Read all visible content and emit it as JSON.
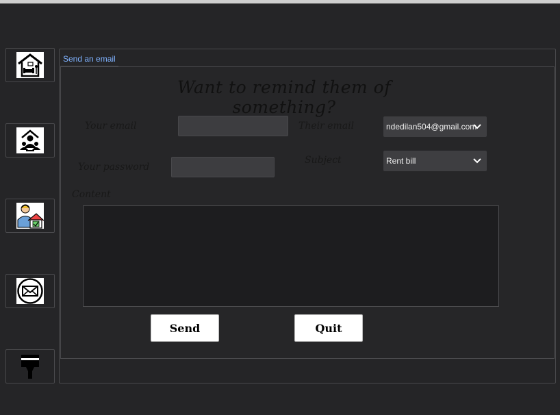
{
  "sidebar": {
    "items": [
      {
        "name": "home",
        "icon": "house-icon"
      },
      {
        "name": "tenants",
        "icon": "tenant-group-icon"
      },
      {
        "name": "landlord",
        "icon": "landlord-house-icon"
      },
      {
        "name": "email",
        "icon": "envelope-icon"
      },
      {
        "name": "theme",
        "icon": "paint-brush-icon"
      }
    ]
  },
  "tab": {
    "label": "Send an email"
  },
  "form": {
    "title": "Want to remind them of something?",
    "your_email_label": "Your email",
    "your_email_value": "",
    "their_email_label": "Their email",
    "their_email_value": "ndedilan504@gmail.com",
    "your_password_label": "Your password",
    "your_password_value": "",
    "subject_label": "Subject",
    "subject_value": "Rent bill",
    "content_label": "Content",
    "content_value": ""
  },
  "buttons": {
    "send": "Send",
    "quit": "Quit"
  },
  "colors": {
    "background": "#252527",
    "tab_text": "#7fb2ff",
    "field": "#3d3d40"
  }
}
